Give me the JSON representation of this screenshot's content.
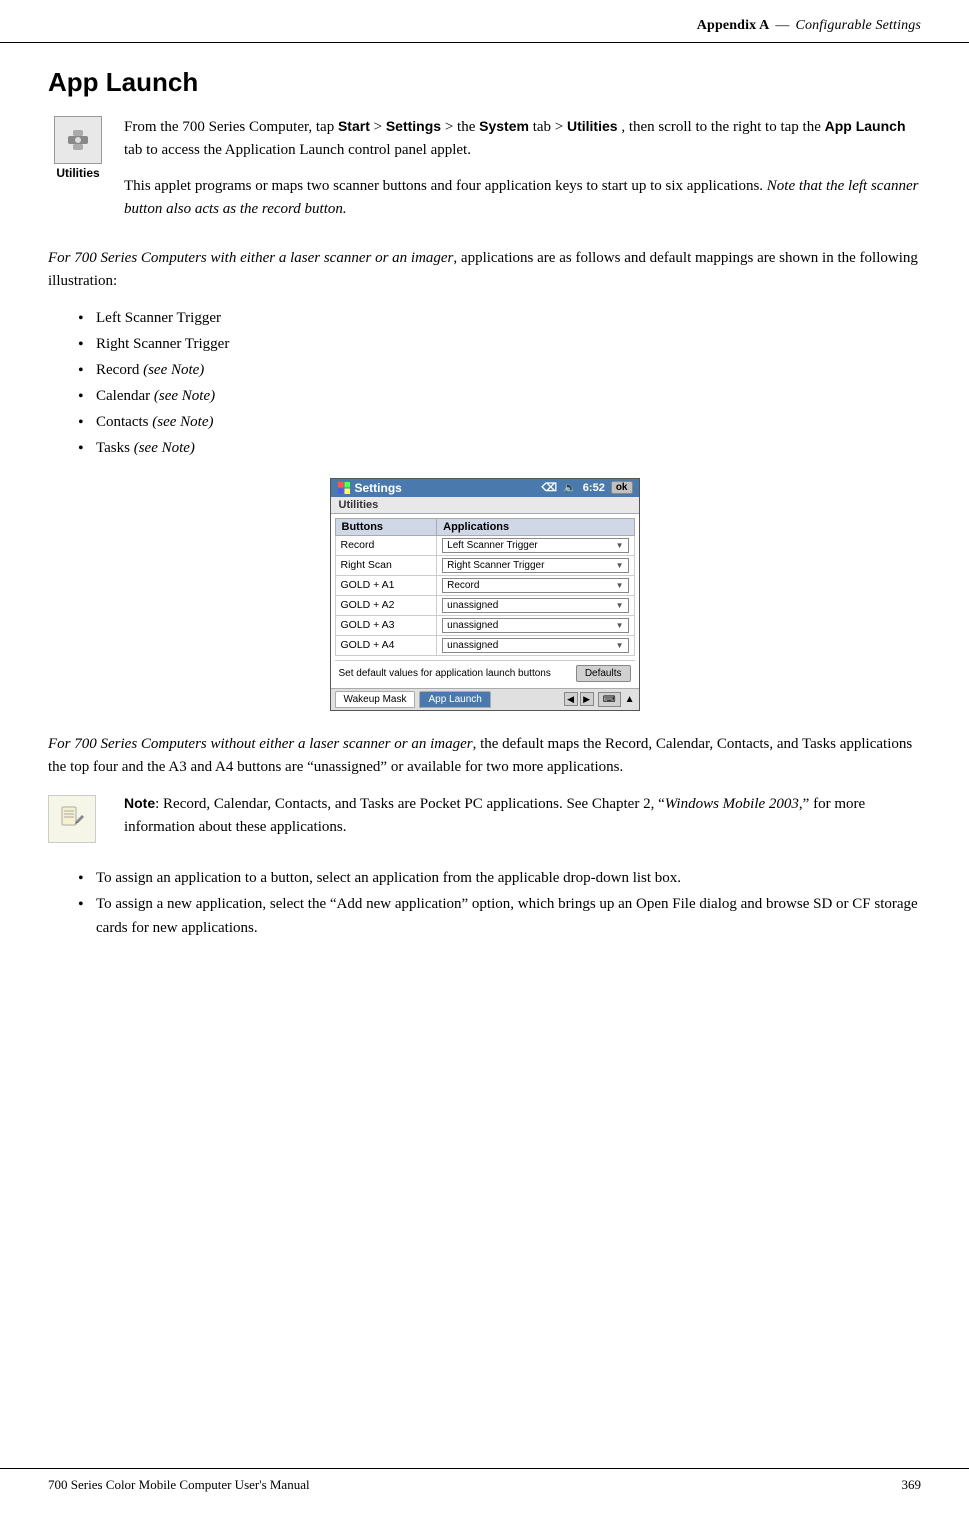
{
  "header": {
    "chapter": "Appendix A",
    "em_dash": "—",
    "title": "Configurable Settings"
  },
  "footer": {
    "manual_title": "700 Series Color Mobile Computer User's Manual",
    "page_number": "369"
  },
  "section": {
    "heading": "App Launch",
    "utilities_label": "Utilities",
    "para1": "From the 700 Series Computer, tap ",
    "para1_start_bold": "Start",
    "para1_gt1": " > ",
    "para1_settings": "Settings",
    "para1_gt2": " > the ",
    "para1_system": "System",
    "para1_tab": " tab > ",
    "para1_utilities": "Utilities",
    "para1_rest": " , then scroll to the right to tap the ",
    "para1_applaunch": "App Launch",
    "para1_end": " tab to access the Application Launch control panel applet.",
    "para2": "This applet programs or maps two scanner buttons and four application keys to start up to six applications. ",
    "para2_italic": "Note that the left scanner button also acts as the record button.",
    "para3_italic": "For 700 Series Computers with either a laser scanner or an imager",
    "para3_rest": ", applications are as follows and default mappings are shown in the following illustration:",
    "bullet_items": [
      "Left Scanner Trigger",
      "Right Scanner Trigger",
      "Record (see Note)",
      "Calendar (see Note)",
      "Contacts (see Note)",
      "Tasks (see Note)"
    ],
    "bullet_record_plain": "Record",
    "bullet_record_italic": " (see Note)",
    "bullet_calendar_plain": "Calendar",
    "bullet_calendar_italic": " (see Note)",
    "bullet_contacts_plain": "Contacts",
    "bullet_contacts_italic": " (see Note)",
    "bullet_tasks_plain": "Tasks",
    "bullet_tasks_italic": " (see Note)",
    "screenshot": {
      "titlebar_title": "Settings",
      "titlebar_time": "6:52",
      "ok_label": "ok",
      "tab_label": "Utilities",
      "col_buttons": "Buttons",
      "col_applications": "Applications",
      "rows": [
        {
          "button": "Record",
          "application": "Left Scanner Trigger"
        },
        {
          "button": "Right Scan",
          "application": "Right Scanner Trigger"
        },
        {
          "button": "GOLD + A1",
          "application": "Record"
        },
        {
          "button": "GOLD + A2",
          "application": "unassigned"
        },
        {
          "button": "GOLD + A3",
          "application": "unassigned"
        },
        {
          "button": "GOLD + A4",
          "application": "unassigned"
        }
      ],
      "defaults_label": "Set default values for application launch buttons",
      "defaults_btn": "Defaults",
      "bottom_tab1": "Wakeup Mask",
      "bottom_tab2": "App Launch"
    },
    "para4_italic": "For 700 Series Computers without either a laser scanner or an imager",
    "para4_rest": ", the default maps the Record, Calendar, Contacts, and Tasks applications the top four and the A3 and A4 buttons are “unassigned” or available for two more applications.",
    "note_label": "Note",
    "note_text": ": Record, Calendar, Contacts, and Tasks are Pocket PC applications. See Chapter 2, “",
    "note_italic": "Windows Mobile 2003",
    "note_text2": ",” for more information about these applications.",
    "bullet2_items": [
      {
        "text": "To assign an application to a button, select an application from the applicable drop-down list box."
      },
      {
        "text": "To assign a new application, select the “Add new application” option, which brings up an Open File dialog and browse SD or CF storage cards for new applications."
      }
    ]
  }
}
